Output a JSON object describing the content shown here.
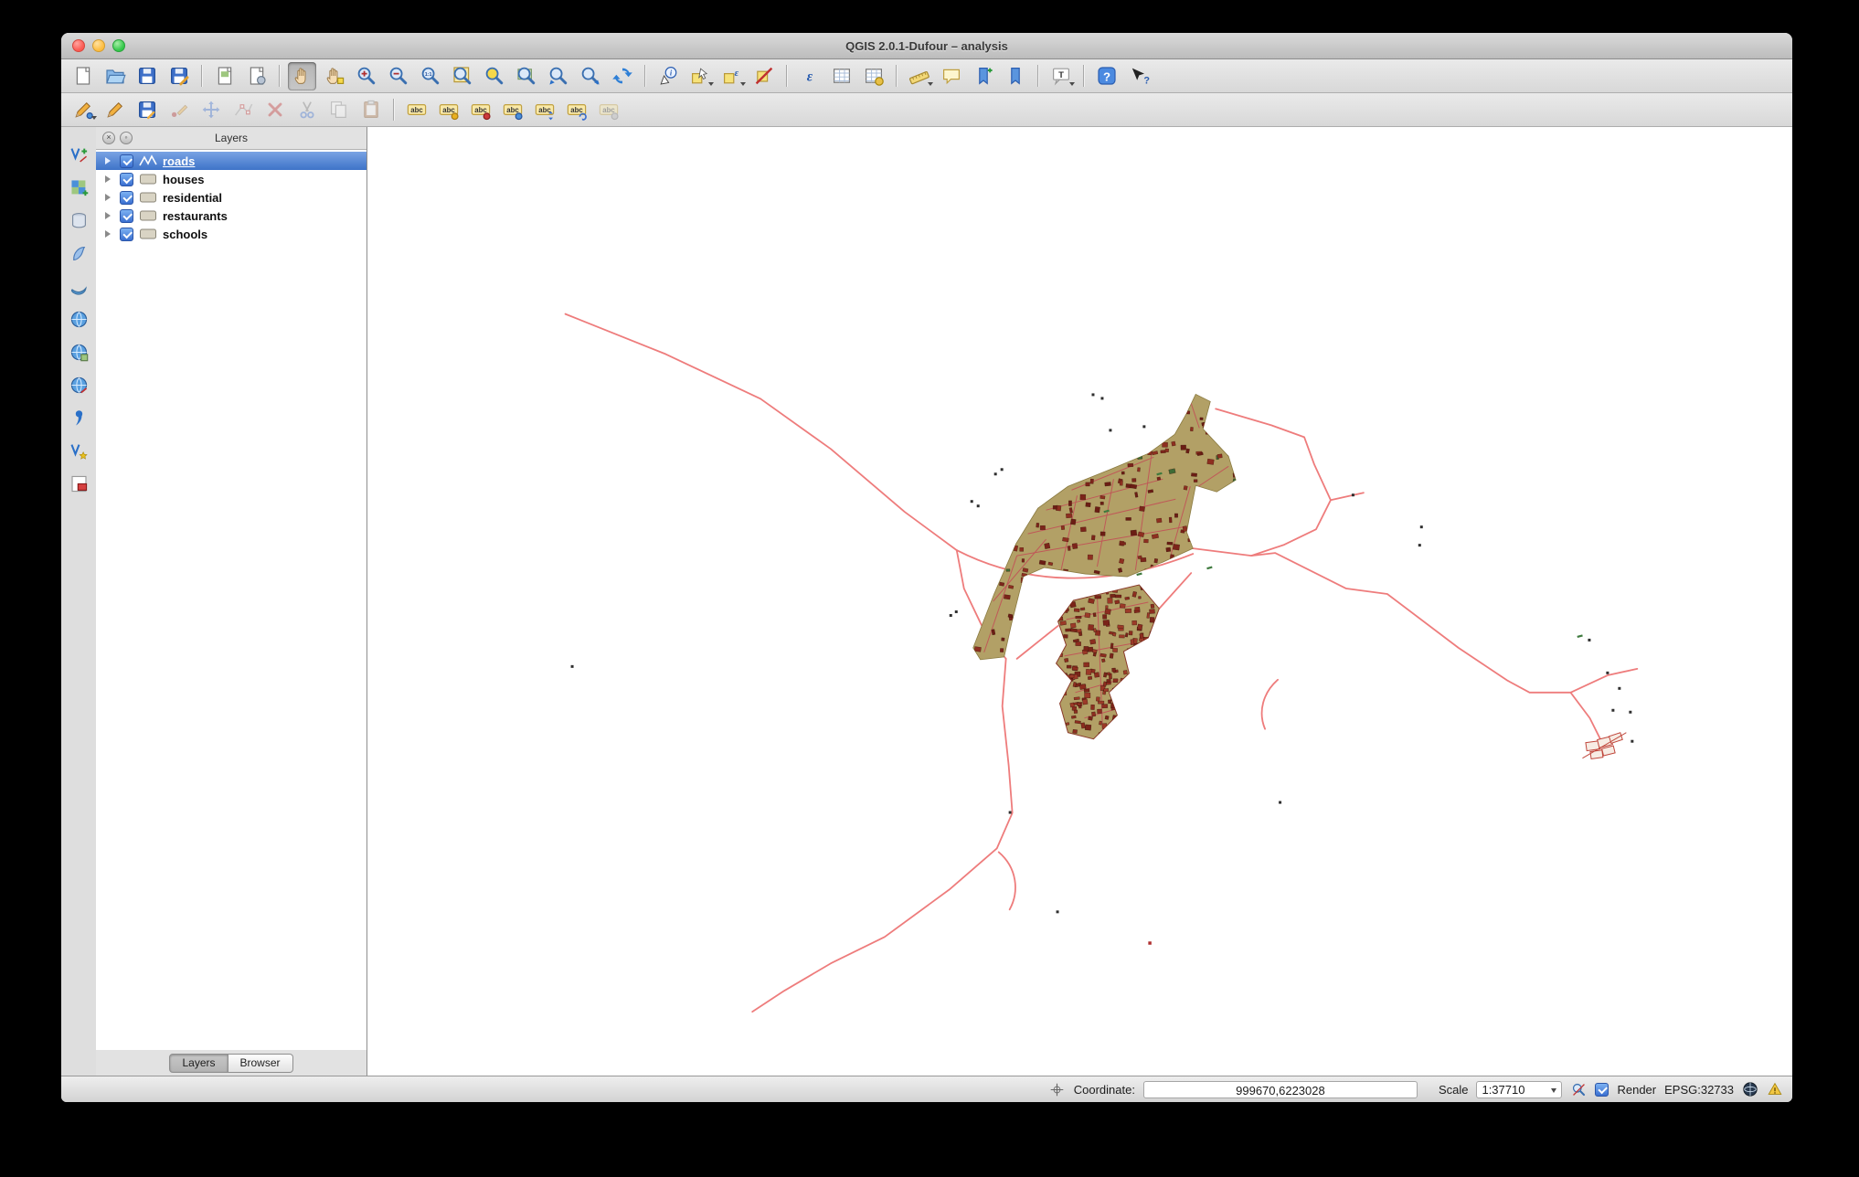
{
  "window": {
    "title": "QGIS 2.0.1-Dufour – analysis"
  },
  "toolbars": {
    "main": [
      {
        "n": "new-project"
      },
      {
        "n": "open-project"
      },
      {
        "n": "save-project"
      },
      {
        "n": "save-project-as"
      },
      {
        "n": "new-composer",
        "sep": true
      },
      {
        "n": "composer-manager"
      },
      {
        "n": "pan-map",
        "sep": true,
        "act": true
      },
      {
        "n": "pan-to-selection"
      },
      {
        "n": "zoom-in"
      },
      {
        "n": "zoom-out"
      },
      {
        "n": "zoom-native"
      },
      {
        "n": "zoom-full"
      },
      {
        "n": "zoom-to-selection"
      },
      {
        "n": "zoom-to-layer"
      },
      {
        "n": "zoom-last"
      },
      {
        "n": "zoom-next"
      },
      {
        "n": "refresh"
      },
      {
        "n": "identify",
        "sep": true
      },
      {
        "n": "select-features",
        "dd": true
      },
      {
        "n": "select-by-expression",
        "dd": true
      },
      {
        "n": "deselect-all"
      },
      {
        "n": "field-expression",
        "sep": true
      },
      {
        "n": "attribute-table"
      },
      {
        "n": "field-calculator"
      },
      {
        "n": "measure",
        "dd": true,
        "sep": true
      },
      {
        "n": "map-tips"
      },
      {
        "n": "new-bookmark"
      },
      {
        "n": "show-bookmarks"
      },
      {
        "n": "text-annotation",
        "dd": true,
        "sep": true
      },
      {
        "n": "help",
        "sep": true
      },
      {
        "n": "whats-this"
      }
    ],
    "edit": [
      {
        "n": "current-edits",
        "dd": true
      },
      {
        "n": "toggle-editing"
      },
      {
        "n": "save-layer-edits"
      },
      {
        "n": "add-feature",
        "dis": true
      },
      {
        "n": "move-feature",
        "dis": true
      },
      {
        "n": "node-tool",
        "dis": true
      },
      {
        "n": "delete-selected",
        "dis": true
      },
      {
        "n": "cut-features",
        "dis": true
      },
      {
        "n": "copy-features",
        "dis": true
      },
      {
        "n": "paste-features",
        "dis": true
      },
      {
        "n": "labeling",
        "sep": true
      },
      {
        "n": "label-pin"
      },
      {
        "n": "label-red"
      },
      {
        "n": "label-show"
      },
      {
        "n": "label-move"
      },
      {
        "n": "label-rotate"
      },
      {
        "n": "label-properties",
        "dis": true
      }
    ],
    "left": [
      {
        "n": "add-vector-layer"
      },
      {
        "n": "add-raster-layer"
      },
      {
        "n": "add-postgis-layer"
      },
      {
        "n": "add-spatialite-layer"
      },
      {
        "n": "add-mssql-layer"
      },
      {
        "n": "add-wms-layer"
      },
      {
        "n": "add-wcs-layer"
      },
      {
        "n": "add-wfs-layer"
      },
      {
        "n": "add-delimited-text-layer"
      },
      {
        "n": "new-shapefile-layer"
      },
      {
        "n": "remove-layer"
      }
    ]
  },
  "layers_panel": {
    "title": "Layers",
    "layers": [
      {
        "label": "roads",
        "checked": true,
        "selected": true
      },
      {
        "label": "houses",
        "checked": true,
        "selected": false
      },
      {
        "label": "residential",
        "checked": true,
        "selected": false
      },
      {
        "label": "restaurants",
        "checked": true,
        "selected": false
      },
      {
        "label": "schools",
        "checked": true,
        "selected": false
      }
    ],
    "tabs": [
      {
        "label": "Layers",
        "active": true
      },
      {
        "label": "Browser",
        "active": false
      }
    ]
  },
  "status_bar": {
    "coordinate_label": "Coordinate:",
    "coordinate_value": "999670,6223028",
    "scale_label": "Scale",
    "scale_value": "1:37710",
    "render_label": "Render",
    "crs_label": "EPSG:32733"
  },
  "colors": {
    "road": "#ee7c7c",
    "town_fill": "#b2a066",
    "building": "#7c241a",
    "district_building": "#8c2d1f",
    "selection": "#3f74c9"
  }
}
